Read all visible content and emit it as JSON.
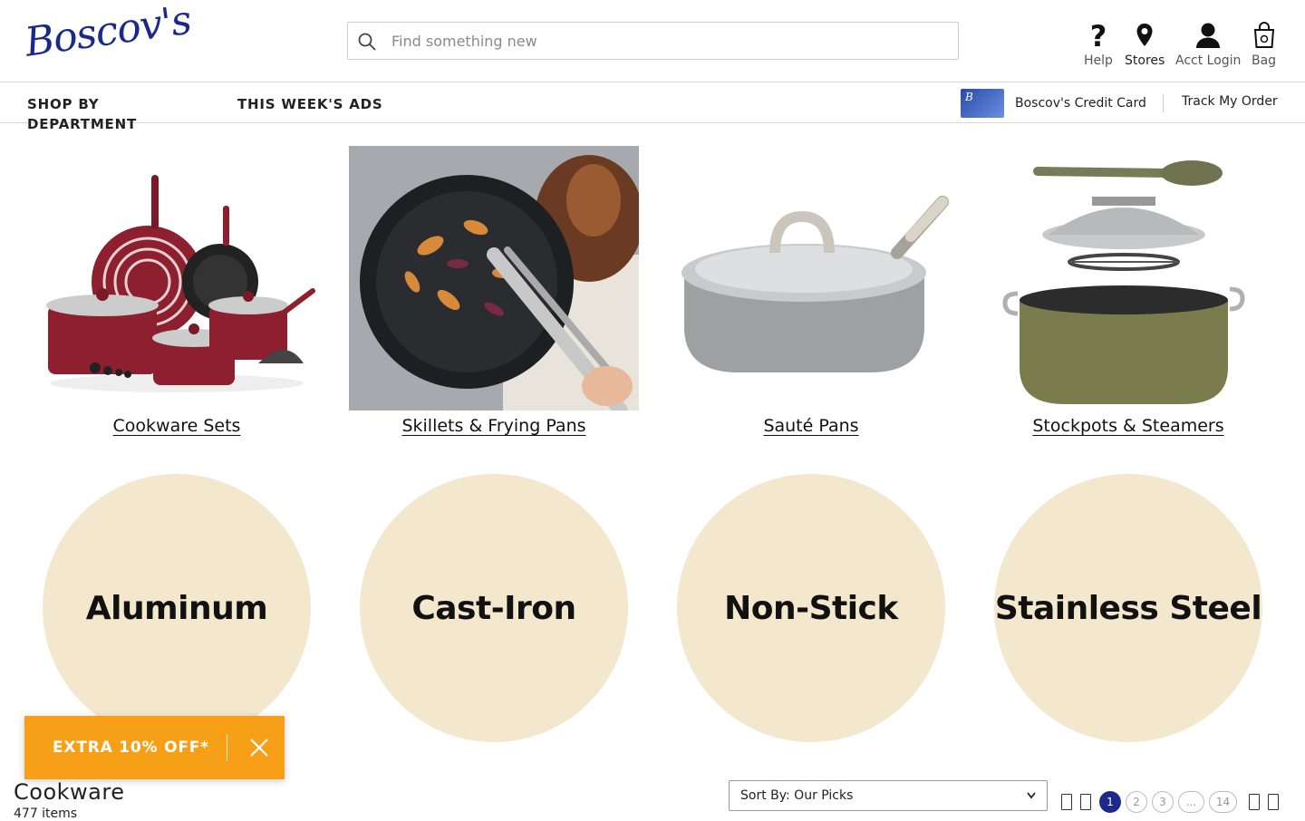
{
  "brand": {
    "name": "Boscov's"
  },
  "search": {
    "placeholder": "Find something new",
    "value": ""
  },
  "utility": [
    {
      "label": "Help",
      "icon": "question-icon"
    },
    {
      "label": "Stores",
      "icon": "location-pin-icon"
    },
    {
      "label": "Acct Login",
      "icon": "user-icon"
    },
    {
      "label": "Bag",
      "icon": "shopping-bag-icon"
    }
  ],
  "nav": {
    "shop_by_department": "SHOP BY DEPARTMENT",
    "weekly_ads": "THIS WEEK'S ADS",
    "credit_card": "Boscov's Credit Card",
    "track_order": "Track My Order"
  },
  "categories": [
    {
      "label": "Cookware Sets"
    },
    {
      "label": "Skillets & Frying Pans"
    },
    {
      "label": "Sauté Pans"
    },
    {
      "label": "Stockpots & Steamers"
    }
  ],
  "materials": [
    {
      "label": "Aluminum"
    },
    {
      "label": "Cast-Iron"
    },
    {
      "label": "Non-Stick"
    },
    {
      "label": "Stainless Steel"
    }
  ],
  "promo": {
    "label": "EXTRA 10% OFF*"
  },
  "listing": {
    "title": "Cookware",
    "count": "477 items",
    "sort_label": "Sort By: Our Picks"
  },
  "pagination": {
    "pages": [
      "1",
      "2",
      "3",
      "...",
      "14"
    ],
    "current": "1"
  },
  "colors": {
    "brand_blue": "#1b2a8a",
    "promo_orange": "#f7a017",
    "circle_cream": "#f3e8cd"
  }
}
